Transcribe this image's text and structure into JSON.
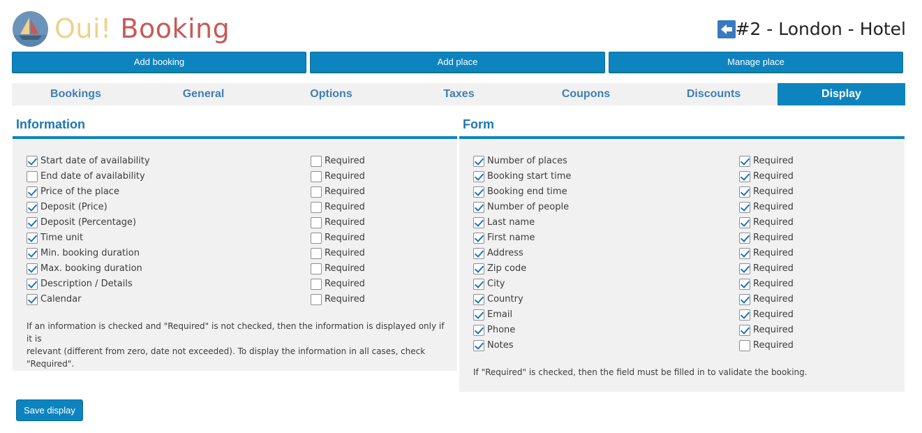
{
  "brand": {
    "part1": "Oui!",
    "part2": "Booking"
  },
  "header": {
    "place_title": "#2 - London - Hotel"
  },
  "actions": {
    "add_booking": "Add booking",
    "add_place": "Add place",
    "manage_place": "Manage place"
  },
  "tabs": [
    "Bookings",
    "General",
    "Options",
    "Taxes",
    "Coupons",
    "Discounts",
    "Display"
  ],
  "active_tab": "Display",
  "information": {
    "title": "Information",
    "required_label": "Required",
    "items": [
      {
        "label": "Start date of availability",
        "checked": true,
        "required": false
      },
      {
        "label": "End date of availability",
        "checked": false,
        "required": false
      },
      {
        "label": "Price of the place",
        "checked": true,
        "required": false
      },
      {
        "label": "Deposit (Price)",
        "checked": true,
        "required": false
      },
      {
        "label": "Deposit (Percentage)",
        "checked": true,
        "required": false
      },
      {
        "label": "Time unit",
        "checked": true,
        "required": false
      },
      {
        "label": "Min. booking duration",
        "checked": true,
        "required": false
      },
      {
        "label": "Max. booking duration",
        "checked": true,
        "required": false
      },
      {
        "label": "Description / Details",
        "checked": true,
        "required": false
      },
      {
        "label": "Calendar",
        "checked": true,
        "required": false
      }
    ],
    "note_lines": [
      "If an information is checked and \"Required\" is not checked, then the information is displayed only if it is",
      "relevant (different from zero, date not exceeded). To display the information in all cases, check",
      "\"Required\"."
    ]
  },
  "form": {
    "title": "Form",
    "required_label": "Required",
    "items": [
      {
        "label": "Number of places",
        "checked": true,
        "required": true
      },
      {
        "label": "Booking start time",
        "checked": true,
        "required": true
      },
      {
        "label": "Booking end time",
        "checked": true,
        "required": true
      },
      {
        "label": "Number of people",
        "checked": true,
        "required": true
      },
      {
        "label": "Last name",
        "checked": true,
        "required": true
      },
      {
        "label": "First name",
        "checked": true,
        "required": true
      },
      {
        "label": "Address",
        "checked": true,
        "required": true
      },
      {
        "label": "Zip code",
        "checked": true,
        "required": true
      },
      {
        "label": "City",
        "checked": true,
        "required": true
      },
      {
        "label": "Country",
        "checked": true,
        "required": true
      },
      {
        "label": "Email",
        "checked": true,
        "required": true
      },
      {
        "label": "Phone",
        "checked": true,
        "required": true
      },
      {
        "label": "Notes",
        "checked": true,
        "required": false
      }
    ],
    "note": "If \"Required\" is checked, then the field must be filled in to validate the booking."
  },
  "save_button": "Save display",
  "colors": {
    "accent": "#0d84bf",
    "tab_text": "#3e7fb3",
    "brand_yellow": "#f2cf8c",
    "brand_red": "#c75a57"
  }
}
